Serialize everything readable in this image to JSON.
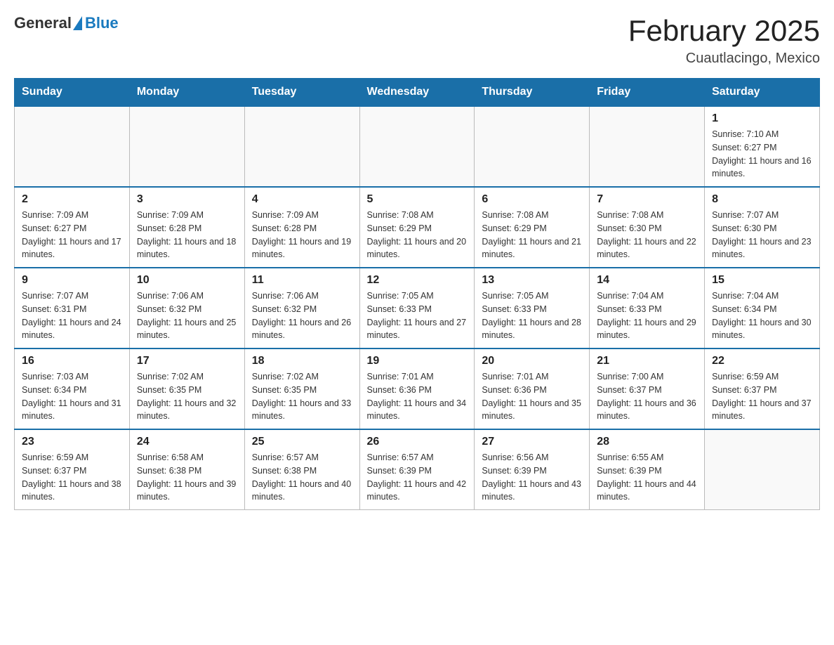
{
  "header": {
    "logo_general": "General",
    "logo_blue": "Blue",
    "month": "February 2025",
    "location": "Cuautlacingo, Mexico"
  },
  "weekdays": [
    "Sunday",
    "Monday",
    "Tuesday",
    "Wednesday",
    "Thursday",
    "Friday",
    "Saturday"
  ],
  "weeks": [
    [
      {
        "day": "",
        "info": ""
      },
      {
        "day": "",
        "info": ""
      },
      {
        "day": "",
        "info": ""
      },
      {
        "day": "",
        "info": ""
      },
      {
        "day": "",
        "info": ""
      },
      {
        "day": "",
        "info": ""
      },
      {
        "day": "1",
        "info": "Sunrise: 7:10 AM\nSunset: 6:27 PM\nDaylight: 11 hours and 16 minutes."
      }
    ],
    [
      {
        "day": "2",
        "info": "Sunrise: 7:09 AM\nSunset: 6:27 PM\nDaylight: 11 hours and 17 minutes."
      },
      {
        "day": "3",
        "info": "Sunrise: 7:09 AM\nSunset: 6:28 PM\nDaylight: 11 hours and 18 minutes."
      },
      {
        "day": "4",
        "info": "Sunrise: 7:09 AM\nSunset: 6:28 PM\nDaylight: 11 hours and 19 minutes."
      },
      {
        "day": "5",
        "info": "Sunrise: 7:08 AM\nSunset: 6:29 PM\nDaylight: 11 hours and 20 minutes."
      },
      {
        "day": "6",
        "info": "Sunrise: 7:08 AM\nSunset: 6:29 PM\nDaylight: 11 hours and 21 minutes."
      },
      {
        "day": "7",
        "info": "Sunrise: 7:08 AM\nSunset: 6:30 PM\nDaylight: 11 hours and 22 minutes."
      },
      {
        "day": "8",
        "info": "Sunrise: 7:07 AM\nSunset: 6:30 PM\nDaylight: 11 hours and 23 minutes."
      }
    ],
    [
      {
        "day": "9",
        "info": "Sunrise: 7:07 AM\nSunset: 6:31 PM\nDaylight: 11 hours and 24 minutes."
      },
      {
        "day": "10",
        "info": "Sunrise: 7:06 AM\nSunset: 6:32 PM\nDaylight: 11 hours and 25 minutes."
      },
      {
        "day": "11",
        "info": "Sunrise: 7:06 AM\nSunset: 6:32 PM\nDaylight: 11 hours and 26 minutes."
      },
      {
        "day": "12",
        "info": "Sunrise: 7:05 AM\nSunset: 6:33 PM\nDaylight: 11 hours and 27 minutes."
      },
      {
        "day": "13",
        "info": "Sunrise: 7:05 AM\nSunset: 6:33 PM\nDaylight: 11 hours and 28 minutes."
      },
      {
        "day": "14",
        "info": "Sunrise: 7:04 AM\nSunset: 6:33 PM\nDaylight: 11 hours and 29 minutes."
      },
      {
        "day": "15",
        "info": "Sunrise: 7:04 AM\nSunset: 6:34 PM\nDaylight: 11 hours and 30 minutes."
      }
    ],
    [
      {
        "day": "16",
        "info": "Sunrise: 7:03 AM\nSunset: 6:34 PM\nDaylight: 11 hours and 31 minutes."
      },
      {
        "day": "17",
        "info": "Sunrise: 7:02 AM\nSunset: 6:35 PM\nDaylight: 11 hours and 32 minutes."
      },
      {
        "day": "18",
        "info": "Sunrise: 7:02 AM\nSunset: 6:35 PM\nDaylight: 11 hours and 33 minutes."
      },
      {
        "day": "19",
        "info": "Sunrise: 7:01 AM\nSunset: 6:36 PM\nDaylight: 11 hours and 34 minutes."
      },
      {
        "day": "20",
        "info": "Sunrise: 7:01 AM\nSunset: 6:36 PM\nDaylight: 11 hours and 35 minutes."
      },
      {
        "day": "21",
        "info": "Sunrise: 7:00 AM\nSunset: 6:37 PM\nDaylight: 11 hours and 36 minutes."
      },
      {
        "day": "22",
        "info": "Sunrise: 6:59 AM\nSunset: 6:37 PM\nDaylight: 11 hours and 37 minutes."
      }
    ],
    [
      {
        "day": "23",
        "info": "Sunrise: 6:59 AM\nSunset: 6:37 PM\nDaylight: 11 hours and 38 minutes."
      },
      {
        "day": "24",
        "info": "Sunrise: 6:58 AM\nSunset: 6:38 PM\nDaylight: 11 hours and 39 minutes."
      },
      {
        "day": "25",
        "info": "Sunrise: 6:57 AM\nSunset: 6:38 PM\nDaylight: 11 hours and 40 minutes."
      },
      {
        "day": "26",
        "info": "Sunrise: 6:57 AM\nSunset: 6:39 PM\nDaylight: 11 hours and 42 minutes."
      },
      {
        "day": "27",
        "info": "Sunrise: 6:56 AM\nSunset: 6:39 PM\nDaylight: 11 hours and 43 minutes."
      },
      {
        "day": "28",
        "info": "Sunrise: 6:55 AM\nSunset: 6:39 PM\nDaylight: 11 hours and 44 minutes."
      },
      {
        "day": "",
        "info": ""
      }
    ]
  ]
}
